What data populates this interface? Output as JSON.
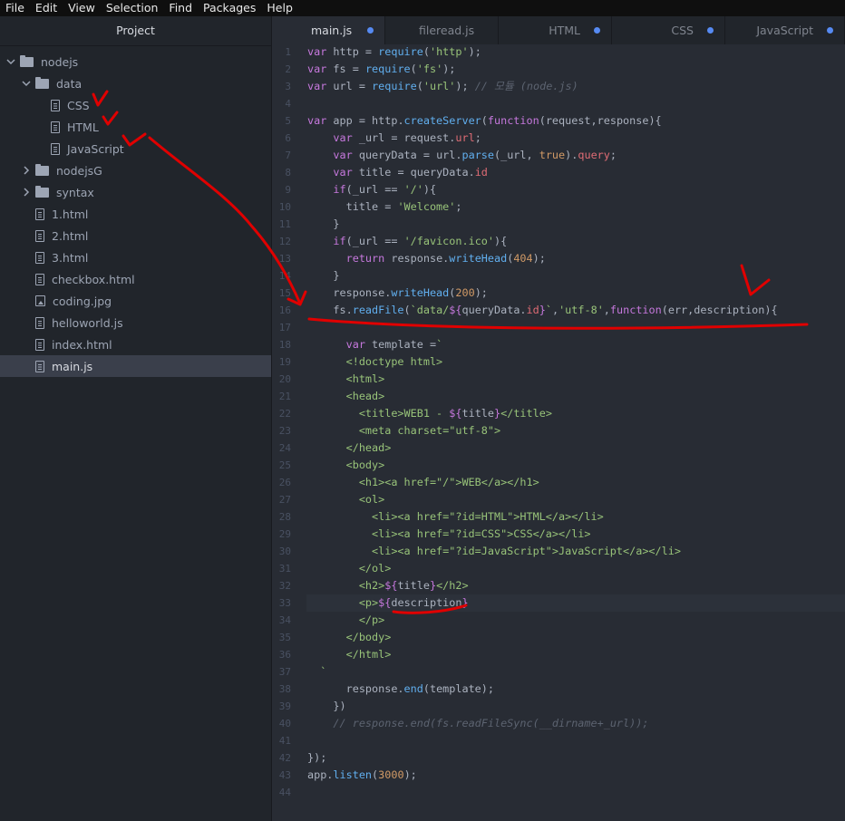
{
  "menu": [
    "File",
    "Edit",
    "View",
    "Selection",
    "Find",
    "Packages",
    "Help"
  ],
  "sidebar": {
    "title": "Project",
    "items": [
      {
        "label": "nodejs",
        "type": "folder",
        "open": true,
        "depth": 0
      },
      {
        "label": "data",
        "type": "folder",
        "open": true,
        "depth": 1
      },
      {
        "label": "CSS",
        "type": "file",
        "depth": 2
      },
      {
        "label": "HTML",
        "type": "file",
        "depth": 2
      },
      {
        "label": "JavaScript",
        "type": "file",
        "depth": 2
      },
      {
        "label": "nodejsG",
        "type": "folder",
        "open": false,
        "depth": 1
      },
      {
        "label": "syntax",
        "type": "folder",
        "open": false,
        "depth": 1
      },
      {
        "label": "1.html",
        "type": "file",
        "depth": 1
      },
      {
        "label": "2.html",
        "type": "file",
        "depth": 1
      },
      {
        "label": "3.html",
        "type": "file",
        "depth": 1
      },
      {
        "label": "checkbox.html",
        "type": "file",
        "depth": 1
      },
      {
        "label": "coding.jpg",
        "type": "image",
        "depth": 1
      },
      {
        "label": "helloworld.js",
        "type": "file",
        "depth": 1
      },
      {
        "label": "index.html",
        "type": "file",
        "depth": 1
      },
      {
        "label": "main.js",
        "type": "file",
        "depth": 1,
        "selected": true
      }
    ]
  },
  "tabs": [
    {
      "label": "main.js",
      "active": true,
      "modified": true
    },
    {
      "label": "fileread.js",
      "active": false,
      "modified": false
    },
    {
      "label": "HTML",
      "active": false,
      "modified": true
    },
    {
      "label": "CSS",
      "active": false,
      "modified": true
    },
    {
      "label": "JavaScript",
      "active": false,
      "modified": true
    }
  ],
  "editor": {
    "current_line": 33,
    "lines": [
      [
        [
          "kw",
          "var"
        ],
        [
          "pl",
          " http = "
        ],
        [
          "fn",
          "require"
        ],
        [
          "pl",
          "("
        ],
        [
          "str",
          "'http'"
        ],
        [
          "pl",
          ");"
        ]
      ],
      [
        [
          "kw",
          "var"
        ],
        [
          "pl",
          " fs = "
        ],
        [
          "fn",
          "require"
        ],
        [
          "pl",
          "("
        ],
        [
          "str",
          "'fs'"
        ],
        [
          "pl",
          ");"
        ]
      ],
      [
        [
          "kw",
          "var"
        ],
        [
          "pl",
          " url = "
        ],
        [
          "fn",
          "require"
        ],
        [
          "pl",
          "("
        ],
        [
          "str",
          "'url'"
        ],
        [
          "pl",
          "); "
        ],
        [
          "com",
          "// 모듈 (node.js)"
        ]
      ],
      [],
      [
        [
          "kw",
          "var"
        ],
        [
          "pl",
          " app = http."
        ],
        [
          "fn",
          "createServer"
        ],
        [
          "pl",
          "("
        ],
        [
          "kw",
          "function"
        ],
        [
          "pl",
          "(request,response){"
        ]
      ],
      [
        [
          "pl",
          "    "
        ],
        [
          "kw",
          "var"
        ],
        [
          "pl",
          " _url = request."
        ],
        [
          "var",
          "url"
        ],
        [
          "pl",
          ";"
        ]
      ],
      [
        [
          "pl",
          "    "
        ],
        [
          "kw",
          "var"
        ],
        [
          "pl",
          " queryData = url."
        ],
        [
          "fn",
          "parse"
        ],
        [
          "pl",
          "(_url, "
        ],
        [
          "num",
          "true"
        ],
        [
          "pl",
          ")."
        ],
        [
          "var",
          "query"
        ],
        [
          "pl",
          ";"
        ]
      ],
      [
        [
          "pl",
          "    "
        ],
        [
          "kw",
          "var"
        ],
        [
          "pl",
          " title = queryData."
        ],
        [
          "var",
          "id"
        ]
      ],
      [
        [
          "pl",
          "    "
        ],
        [
          "kw",
          "if"
        ],
        [
          "pl",
          "(_url == "
        ],
        [
          "str",
          "'/'"
        ],
        [
          "pl",
          "){"
        ]
      ],
      [
        [
          "pl",
          "      title = "
        ],
        [
          "str",
          "'Welcome'"
        ],
        [
          "pl",
          ";"
        ]
      ],
      [
        [
          "pl",
          "    }"
        ]
      ],
      [
        [
          "pl",
          "    "
        ],
        [
          "kw",
          "if"
        ],
        [
          "pl",
          "(_url == "
        ],
        [
          "str",
          "'/favicon.ico'"
        ],
        [
          "pl",
          "){"
        ]
      ],
      [
        [
          "pl",
          "      "
        ],
        [
          "kw",
          "return"
        ],
        [
          "pl",
          " response."
        ],
        [
          "fn",
          "writeHead"
        ],
        [
          "pl",
          "("
        ],
        [
          "num",
          "404"
        ],
        [
          "pl",
          ");"
        ]
      ],
      [
        [
          "pl",
          "    }"
        ]
      ],
      [
        [
          "pl",
          "    response."
        ],
        [
          "fn",
          "writeHead"
        ],
        [
          "pl",
          "("
        ],
        [
          "num",
          "200"
        ],
        [
          "pl",
          ");"
        ]
      ],
      [
        [
          "pl",
          "    fs."
        ],
        [
          "fn",
          "readFile"
        ],
        [
          "pl",
          "("
        ],
        [
          "str",
          "`data/"
        ],
        [
          "ip",
          "${"
        ],
        [
          "pl",
          "queryData."
        ],
        [
          "var",
          "id"
        ],
        [
          "ip",
          "}"
        ],
        [
          "str",
          "`"
        ],
        [
          "pl",
          ","
        ],
        [
          "str",
          "'utf-8'"
        ],
        [
          "pl",
          ","
        ],
        [
          "kw",
          "function"
        ],
        [
          "pl",
          "(err,description){"
        ]
      ],
      [],
      [
        [
          "pl",
          "      "
        ],
        [
          "kw",
          "var"
        ],
        [
          "pl",
          " template ="
        ],
        [
          "str",
          "`"
        ]
      ],
      [
        [
          "str",
          "      <!doctype html>"
        ]
      ],
      [
        [
          "str",
          "      <html>"
        ]
      ],
      [
        [
          "str",
          "      <head>"
        ]
      ],
      [
        [
          "str",
          "        <title>WEB1 - "
        ],
        [
          "ip",
          "${"
        ],
        [
          "pl",
          "title"
        ],
        [
          "ip",
          "}"
        ],
        [
          "str",
          "</title>"
        ]
      ],
      [
        [
          "str",
          "        <meta charset=\"utf-8\">"
        ]
      ],
      [
        [
          "str",
          "      </head>"
        ]
      ],
      [
        [
          "str",
          "      <body>"
        ]
      ],
      [
        [
          "str",
          "        <h1><a href=\"/\">WEB</a></h1>"
        ]
      ],
      [
        [
          "str",
          "        <ol>"
        ]
      ],
      [
        [
          "str",
          "          <li><a href=\"?id=HTML\">HTML</a></li>"
        ]
      ],
      [
        [
          "str",
          "          <li><a href=\"?id=CSS\">CSS</a></li>"
        ]
      ],
      [
        [
          "str",
          "          <li><a href=\"?id=JavaScript\">JavaScript</a></li>"
        ]
      ],
      [
        [
          "str",
          "        </ol>"
        ]
      ],
      [
        [
          "str",
          "        <h2>"
        ],
        [
          "ip",
          "${"
        ],
        [
          "pl",
          "title"
        ],
        [
          "ip",
          "}"
        ],
        [
          "str",
          "</h2>"
        ]
      ],
      [
        [
          "str",
          "        <p>"
        ],
        [
          "ip",
          "${"
        ],
        [
          "pl",
          "description"
        ],
        [
          "ip",
          "}"
        ]
      ],
      [
        [
          "str",
          "        </p>"
        ]
      ],
      [
        [
          "str",
          "      </body>"
        ]
      ],
      [
        [
          "str",
          "      </html>"
        ]
      ],
      [
        [
          "str",
          "  `"
        ]
      ],
      [
        [
          "pl",
          "      response."
        ],
        [
          "fn",
          "end"
        ],
        [
          "pl",
          "(template);"
        ]
      ],
      [
        [
          "pl",
          "    })"
        ]
      ],
      [
        [
          "pl",
          "    "
        ],
        [
          "com",
          "// response.end(fs.readFileSync(__dirname+_url));"
        ]
      ],
      [],
      [
        [
          "pl",
          "});"
        ]
      ],
      [
        [
          "pl",
          "app."
        ],
        [
          "fn",
          "listen"
        ],
        [
          "pl",
          "("
        ],
        [
          "num",
          "3000"
        ],
        [
          "pl",
          ");"
        ]
      ],
      []
    ]
  },
  "colors": {
    "annotation": "#e00000",
    "accent": "#568af2"
  }
}
